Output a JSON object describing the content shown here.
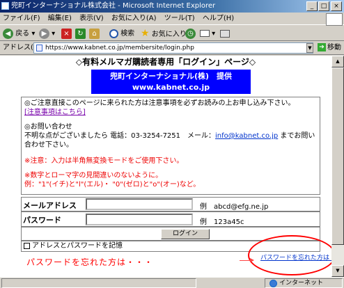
{
  "window": {
    "title": "兜町インターナショナル株式会社 - Microsoft Internet Explorer"
  },
  "menu": {
    "file": "ファイル(F)",
    "edit": "編集(E)",
    "view": "表示(V)",
    "favorites": "お気に入り(A)",
    "tools": "ツール(T)",
    "help": "ヘルプ(H)"
  },
  "toolbar": {
    "back": "戻る",
    "search": "検索",
    "favorites": "お気に入り"
  },
  "address": {
    "label": "アドレス(D)",
    "url": "https://www.kabnet.co.jp/membersite/login.php",
    "go": "移動"
  },
  "page": {
    "heading": "◇有料メルマガ購読者専用「ログイン」ページ◇",
    "banner_line1": "兜町インターナショナル(株)　提供",
    "banner_line2": "www.kabnet.co.jp",
    "notice_line1": "◎ご注意直接このページに来られた方は注意事項を必ずお読みの上お申し込み下さい。",
    "notice_link": "[注意事項はこちら]",
    "contact_title": "◎お問い合わせ",
    "contact_text_pre": "不明な点がございましたら 電話：03-3254-7251　メール：",
    "contact_email": "info@kabnet.co.jp",
    "contact_text_post": " までお問い合わせ下さい。",
    "warning1": "※注意：入力は半角無変換モードをご使用下さい。",
    "warning2_line1": "※数字とローマ字の見間違いのないように。",
    "warning2_line2": "例：\"1\"(イチ)と\"l\"(エル)・ \"0\"(ゼロ)と\"o\"(オー)など。"
  },
  "form": {
    "email_label": "メールアドレス",
    "email_example": "例　abcd@efg.ne.jp",
    "password_label": "パスワード",
    "password_example": "例　123a45c",
    "login_button": "ログイン",
    "remember_label": "アドレスとパスワードを記憶",
    "forgot_link": "パスワードを忘れた方は・・・"
  },
  "annotation": {
    "text": "パスワードを忘れた方は・・・",
    "color": "#ff0000"
  },
  "status": {
    "zone": "インターネット"
  },
  "colors": {
    "banner_bg": "#0000ff",
    "warning": "#ee0000",
    "link": "#0033cc"
  }
}
